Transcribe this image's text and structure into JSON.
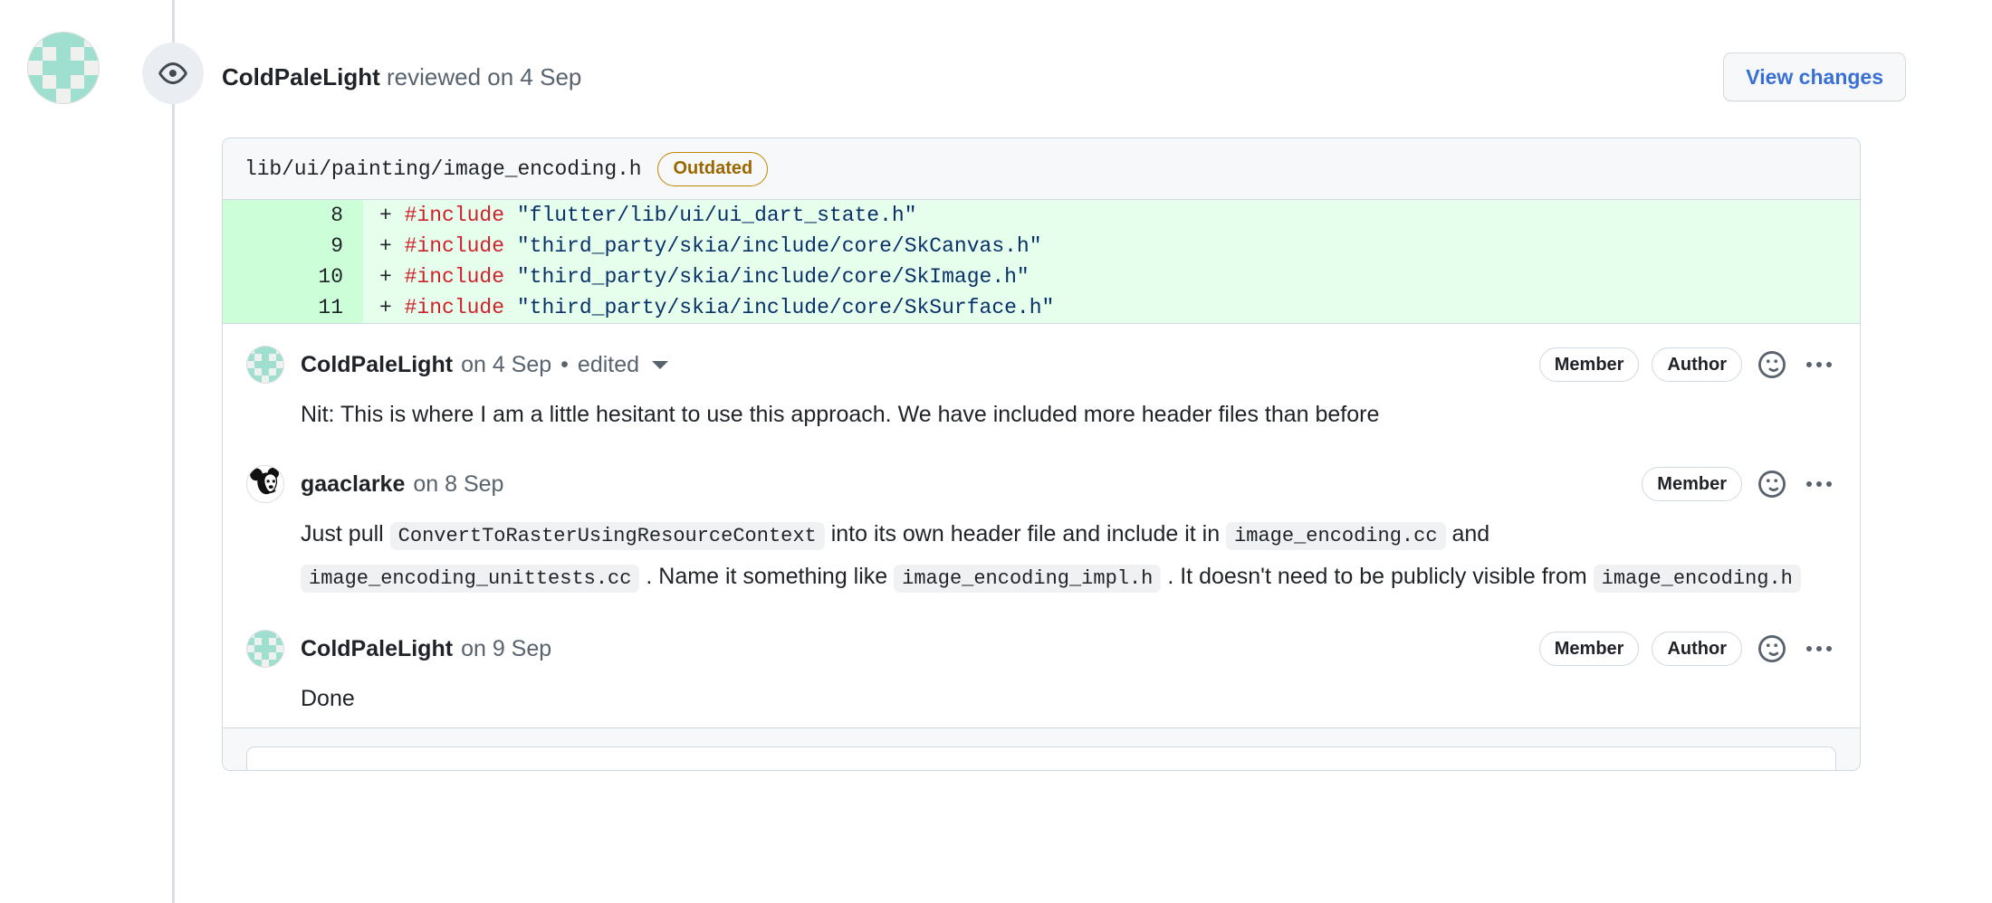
{
  "review": {
    "actor": "ColdPaleLight",
    "action_text": " reviewed on 4 Sep",
    "view_changes_label": "View changes",
    "eye_icon": "eye-icon"
  },
  "file": {
    "path": "lib/ui/painting/image_encoding.h",
    "badge": "Outdated"
  },
  "diff": {
    "lines": [
      {
        "number": "8",
        "marker": "+ ",
        "pre": "#include",
        "str": " \"flutter/lib/ui/ui_dart_state.h\""
      },
      {
        "number": "9",
        "marker": "+ ",
        "pre": "#include",
        "str": " \"third_party/skia/include/core/SkCanvas.h\""
      },
      {
        "number": "10",
        "marker": "+ ",
        "pre": "#include",
        "str": " \"third_party/skia/include/core/SkImage.h\""
      },
      {
        "number": "11",
        "marker": "+ ",
        "pre": "#include",
        "str": " \"third_party/skia/include/core/SkSurface.h\""
      }
    ]
  },
  "comments": [
    {
      "author": "ColdPaleLight",
      "timestamp": "on 4 Sep",
      "separator": "•",
      "edited": "edited",
      "badges": [
        "Member",
        "Author"
      ],
      "reaction_icon": "smiley-icon",
      "menu_icon": "kebab-menu-icon",
      "body_plain": "Nit: This is where I am a little hesitant to use this approach. We have included more header files than before"
    },
    {
      "author": "gaaclarke",
      "timestamp": "on 8 Sep",
      "badges": [
        "Member"
      ],
      "reaction_icon": "smiley-icon",
      "menu_icon": "kebab-menu-icon",
      "body_segments": [
        {
          "type": "text",
          "value": "Just pull "
        },
        {
          "type": "code",
          "value": "ConvertToRasterUsingResourceContext"
        },
        {
          "type": "text",
          "value": " into its own header file and include it in "
        },
        {
          "type": "code",
          "value": "image_encoding.cc"
        },
        {
          "type": "text",
          "value": " and "
        },
        {
          "type": "code",
          "value": "image_encoding_unittests.cc"
        },
        {
          "type": "text",
          "value": " . Name it something like "
        },
        {
          "type": "code",
          "value": "image_encoding_impl.h"
        },
        {
          "type": "text",
          "value": " . It doesn't need to be publicly visible from "
        },
        {
          "type": "code",
          "value": "image_encoding.h"
        }
      ]
    },
    {
      "author": "ColdPaleLight",
      "timestamp": "on 9 Sep",
      "badges": [
        "Member",
        "Author"
      ],
      "reaction_icon": "smiley-icon",
      "menu_icon": "kebab-menu-icon",
      "body_plain": "Done"
    }
  ],
  "colors": {
    "diff_add_bg": "#e6ffec",
    "diff_add_gutter": "#ccffd8",
    "link_blue": "#3a70d4",
    "outdated_border": "#bf8700",
    "outdated_text": "#9a6700",
    "muted_text": "#59636e",
    "border": "#d1d9e0",
    "header_bg": "#f6f8fa",
    "identicon_fg": "#9fdfd0"
  }
}
